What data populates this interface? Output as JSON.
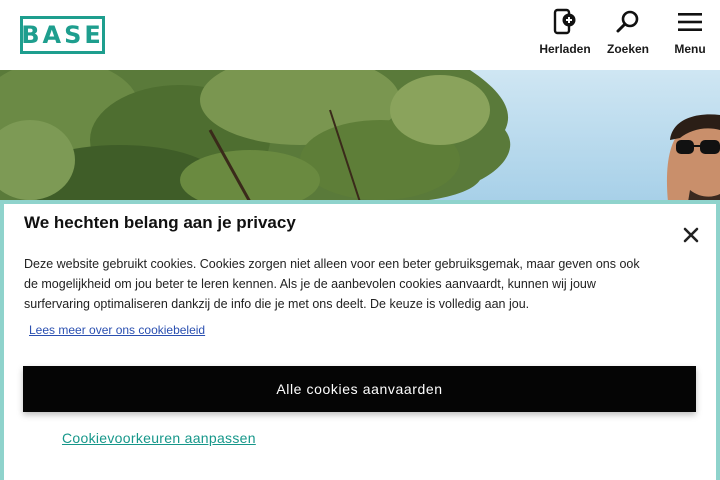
{
  "brand": {
    "logo_text": "BASE",
    "accent_color": "#1e9e8e"
  },
  "header": {
    "nav": [
      {
        "label": "Herladen",
        "icon": "phone-recharge-icon"
      },
      {
        "label": "Zoeken",
        "icon": "search-icon"
      },
      {
        "label": "Menu",
        "icon": "hamburger-menu-icon"
      }
    ]
  },
  "hero": {
    "image": "man-with-sunglasses-under-tree"
  },
  "cookie_banner": {
    "title": "We hechten belang aan je privacy",
    "body": "Deze website gebruikt cookies. Cookies zorgen niet alleen voor een beter gebruiksgemak, maar geven ons ook de mogelijkheid om jou beter te leren kennen. Als je de aanbevolen cookies aanvaardt, kunnen wij jouw surfervaring optimaliseren dankzij de info die je met ons deelt. De keuze is volledig aan jou.",
    "policy_link": "Lees meer over ons cookiebeleid",
    "accept_button": "Alle cookies aanvaarden",
    "preferences_link": "Cookievoorkeuren aanpassen",
    "close_icon": "close-icon",
    "border_color": "#8fd3cc"
  }
}
